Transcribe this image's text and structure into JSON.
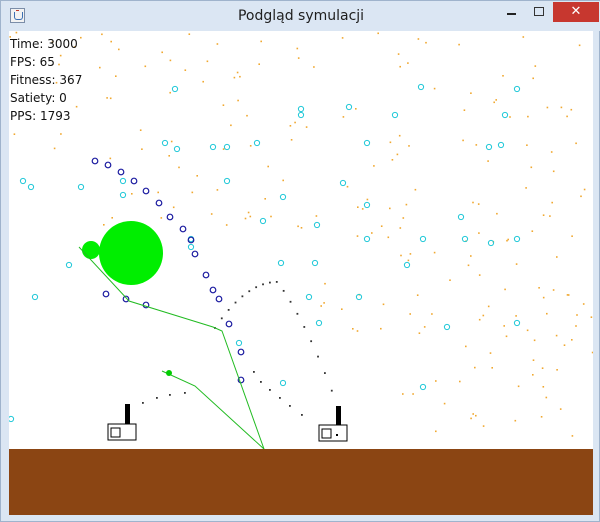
{
  "window": {
    "title": "Podgląd symulacji",
    "minimize_label": "",
    "maximize_label": "",
    "close_label": "✕"
  },
  "hud": {
    "time": "Time: 3000",
    "fps": "FPS: 65",
    "fitness": "Fitness: 367",
    "satiety": "Satiety: 0",
    "pps": "PPS: 1793"
  },
  "colors": {
    "ground": "#8b4513",
    "creature_body": "#00ee00",
    "creature_limb": "#22bb22",
    "food_particles": "#f0a830",
    "cyan_bubbles": "#20c8d8",
    "blue_bubbles": "#1a1aa0",
    "projectile_trail": "#333333",
    "close_button": "#c7372f"
  }
}
